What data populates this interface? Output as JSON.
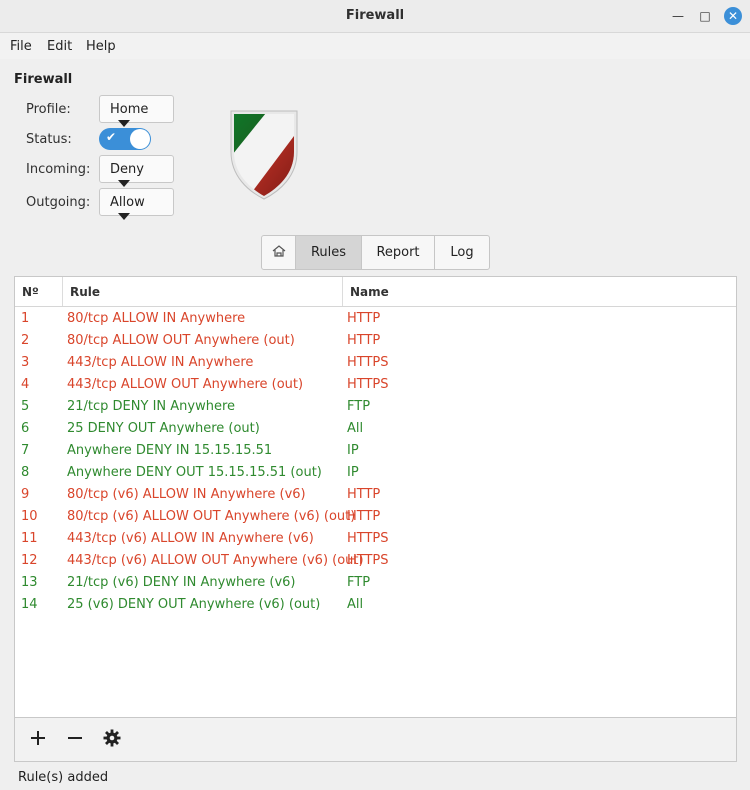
{
  "window": {
    "title": "Firewall"
  },
  "menu": [
    "File",
    "Edit",
    "Help"
  ],
  "section_title": "Firewall",
  "settings": {
    "profile_label": "Profile:",
    "profile_value": "Home",
    "status_label": "Status:",
    "status_on": true,
    "incoming_label": "Incoming:",
    "incoming_value": "Deny",
    "outgoing_label": "Outgoing:",
    "outgoing_value": "Allow"
  },
  "tabs": {
    "rules": "Rules",
    "report": "Report",
    "log": "Log",
    "active": "Rules"
  },
  "table": {
    "headers": [
      "Nº",
      "Rule",
      "Name"
    ],
    "rows": [
      {
        "n": "1",
        "rule": "80/tcp ALLOW IN Anywhere",
        "name": "HTTP",
        "action": "allow"
      },
      {
        "n": "2",
        "rule": "80/tcp ALLOW OUT Anywhere (out)",
        "name": "HTTP",
        "action": "allow"
      },
      {
        "n": "3",
        "rule": "443/tcp ALLOW IN Anywhere",
        "name": "HTTPS",
        "action": "allow"
      },
      {
        "n": "4",
        "rule": "443/tcp ALLOW OUT Anywhere (out)",
        "name": "HTTPS",
        "action": "allow"
      },
      {
        "n": "5",
        "rule": "21/tcp DENY IN Anywhere",
        "name": "FTP",
        "action": "deny"
      },
      {
        "n": "6",
        "rule": "25 DENY OUT Anywhere (out)",
        "name": "All",
        "action": "deny"
      },
      {
        "n": "7",
        "rule": "Anywhere DENY IN 15.15.15.51",
        "name": "IP",
        "action": "deny"
      },
      {
        "n": "8",
        "rule": "Anywhere DENY OUT 15.15.15.51 (out)",
        "name": "IP",
        "action": "deny"
      },
      {
        "n": "9",
        "rule": "80/tcp (v6) ALLOW IN Anywhere (v6)",
        "name": "HTTP",
        "action": "allow"
      },
      {
        "n": "10",
        "rule": "80/tcp (v6) ALLOW OUT Anywhere (v6) (out)",
        "name": "HTTP",
        "action": "allow"
      },
      {
        "n": "11",
        "rule": "443/tcp (v6) ALLOW IN Anywhere (v6)",
        "name": "HTTPS",
        "action": "allow"
      },
      {
        "n": "12",
        "rule": "443/tcp (v6) ALLOW OUT Anywhere (v6) (out)",
        "name": "HTTPS",
        "action": "allow"
      },
      {
        "n": "13",
        "rule": "21/tcp (v6) DENY IN Anywhere (v6)",
        "name": "FTP",
        "action": "deny"
      },
      {
        "n": "14",
        "rule": "25 (v6) DENY OUT Anywhere (v6) (out)",
        "name": "All",
        "action": "deny"
      }
    ]
  },
  "toolbar_icons": [
    "plus-icon",
    "minus-icon",
    "gear-icon"
  ],
  "status_bar": "Rule(s) added",
  "colors": {
    "allow": "#d9452b",
    "deny": "#2f8a2f",
    "accent": "#3b8fd8"
  }
}
